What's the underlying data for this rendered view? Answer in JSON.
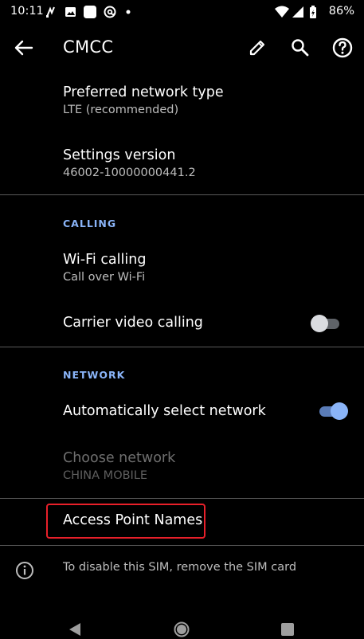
{
  "status_bar": {
    "time": "10:11",
    "battery_percent": "86%",
    "left_icons": [
      "signal-alt-icon",
      "image-icon",
      "square-app-icon",
      "at-sign-icon",
      "dot-icon"
    ],
    "right_icons": [
      "wifi-icon",
      "cellular-icon",
      "battery-icon"
    ]
  },
  "app_bar": {
    "title": "CMCC",
    "icons": [
      "back-arrow-icon",
      "pencil-icon",
      "search-icon",
      "help-icon"
    ]
  },
  "preferences": {
    "network_type": {
      "title": "Preferred network type",
      "summary": "LTE (recommended)"
    },
    "settings_version": {
      "title": "Settings version",
      "summary": "46002-10000000441.2"
    },
    "calling_header": "CALLING",
    "wifi_calling": {
      "title": "Wi-Fi calling",
      "summary": "Call over Wi-Fi"
    },
    "carrier_video": {
      "title": "Carrier video calling",
      "enabled": false
    },
    "network_header": "NETWORK",
    "auto_select": {
      "title": "Automatically select network",
      "enabled": true
    },
    "choose_network": {
      "title": "Choose network",
      "summary": "CHINA MOBILE"
    },
    "apn": {
      "title": "Access Point Names"
    }
  },
  "footer": {
    "text": "To disable this SIM, remove the SIM card"
  },
  "colors": {
    "accent": "#8ab4f8",
    "background": "#000000",
    "highlight": "#e8202a",
    "divider": "#5a5a5a"
  }
}
